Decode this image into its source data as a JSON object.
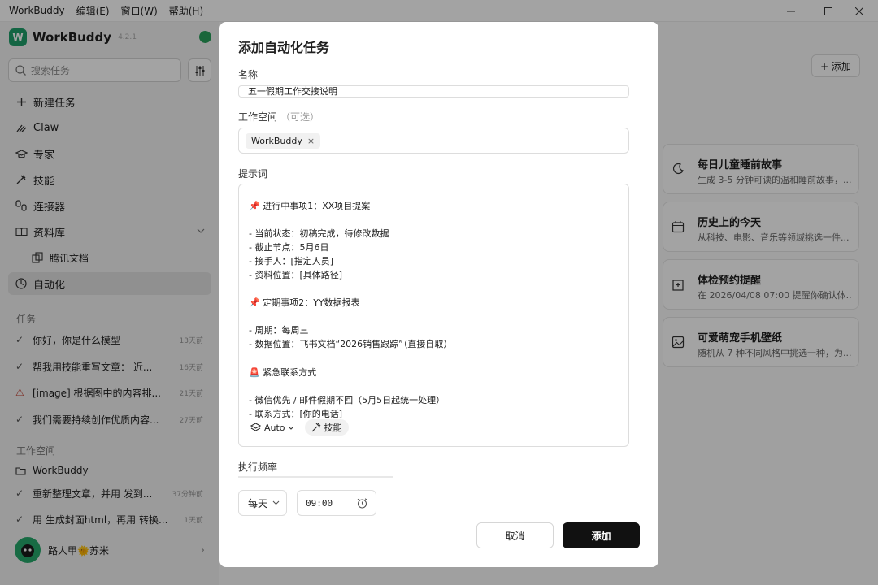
{
  "titlebar": {
    "app_title": "WorkBuddy",
    "menus": [
      "编辑(E)",
      "窗口(W)",
      "帮助(H)"
    ],
    "minimize_icon": "minimize-icon",
    "maximize_icon": "maximize-icon",
    "close_icon": "close-icon"
  },
  "sidebar": {
    "brand": "WorkBuddy",
    "version": "4.2.1",
    "search_placeholder": "搜索任务",
    "nav": [
      {
        "label": "新建任务",
        "icon": "plus-icon"
      },
      {
        "label": "Claw",
        "icon": "claw-icon"
      },
      {
        "label": "专家",
        "icon": "expert-icon"
      },
      {
        "label": "技能",
        "icon": "skill-icon"
      },
      {
        "label": "连接器",
        "icon": "connector-icon"
      },
      {
        "label": "资料库",
        "icon": "book-icon"
      },
      {
        "label": "腾讯文档",
        "icon": "docs-icon"
      },
      {
        "label": "自动化",
        "icon": "clock-icon"
      }
    ],
    "tasks_label": "任务",
    "tasks": [
      {
        "title": "你好，你是什么模型",
        "time": "13天前",
        "status": "check"
      },
      {
        "title": "帮我用技能重写文章： 近...",
        "time": "16天前",
        "status": "check"
      },
      {
        "title": "[image] 根据图中的内容排...",
        "time": "21天前",
        "status": "warning"
      },
      {
        "title": "我们需要持续创作优质内容...",
        "time": "27天前",
        "status": "check"
      }
    ],
    "workspace_label": "工作空间",
    "workspace_name": "WorkBuddy",
    "workspace_tasks": [
      {
        "title": "重新整理文章，并用 发到...",
        "time": "37分钟前"
      },
      {
        "title": "用 生成封面html，再用 转换...",
        "time": "1天前"
      }
    ],
    "user_name": "路人甲🌞苏米"
  },
  "main": {
    "add_label": "+ 添加",
    "cards": [
      {
        "title": "每日儿童睡前故事",
        "desc": "生成 3-5 分钟可读的温和睡前故事，...",
        "icon": "moon-icon"
      },
      {
        "title": "历史上的今天",
        "desc": "从科技、电影、音乐等领域挑选一件...",
        "icon": "calendar-icon"
      },
      {
        "title": "体检预约提醒",
        "desc": "在 2026/04/08 07:00 提醒你确认体...",
        "icon": "hospital-icon"
      },
      {
        "title": "可爱萌宠手机壁纸",
        "desc": "随机从 7 种不同风格中挑选一种，为...",
        "icon": "image-icon"
      }
    ]
  },
  "modal": {
    "title": "添加自动化任务",
    "name_label": "名称",
    "name_value": "五一假期工作交接说明",
    "workspace_label": "工作空间",
    "workspace_optional": "（可选）",
    "workspace_chip": "WorkBuddy",
    "workspace_chip_remove": "×",
    "prompt_label": "提示词",
    "prompt_lines": [
      "📌 进行中事项1：XX项目提案",
      "",
      "- 当前状态：初稿完成，待修改数据",
      "- 截止节点：5月6日",
      "- 接手人：[指定人员]",
      "- 资料位置：[具体路径]",
      "",
      "📌 定期事项2：YY数据报表",
      "",
      "- 周期：每周三",
      "- 数据位置：飞书文档“2026销售跟踪”（直接自取）",
      "",
      "🚨 紧急联系方式",
      "",
      "- 微信优先 / 邮件假期不回（5月5日起统一处理）",
      "- 联系方式：[你的电话]"
    ],
    "model_label": "Auto",
    "skill_label": "技能",
    "frequency_label": "执行频率",
    "frequency_value": "每天",
    "time_value": "09:00",
    "cancel_label": "取消",
    "add_label": "添加"
  }
}
